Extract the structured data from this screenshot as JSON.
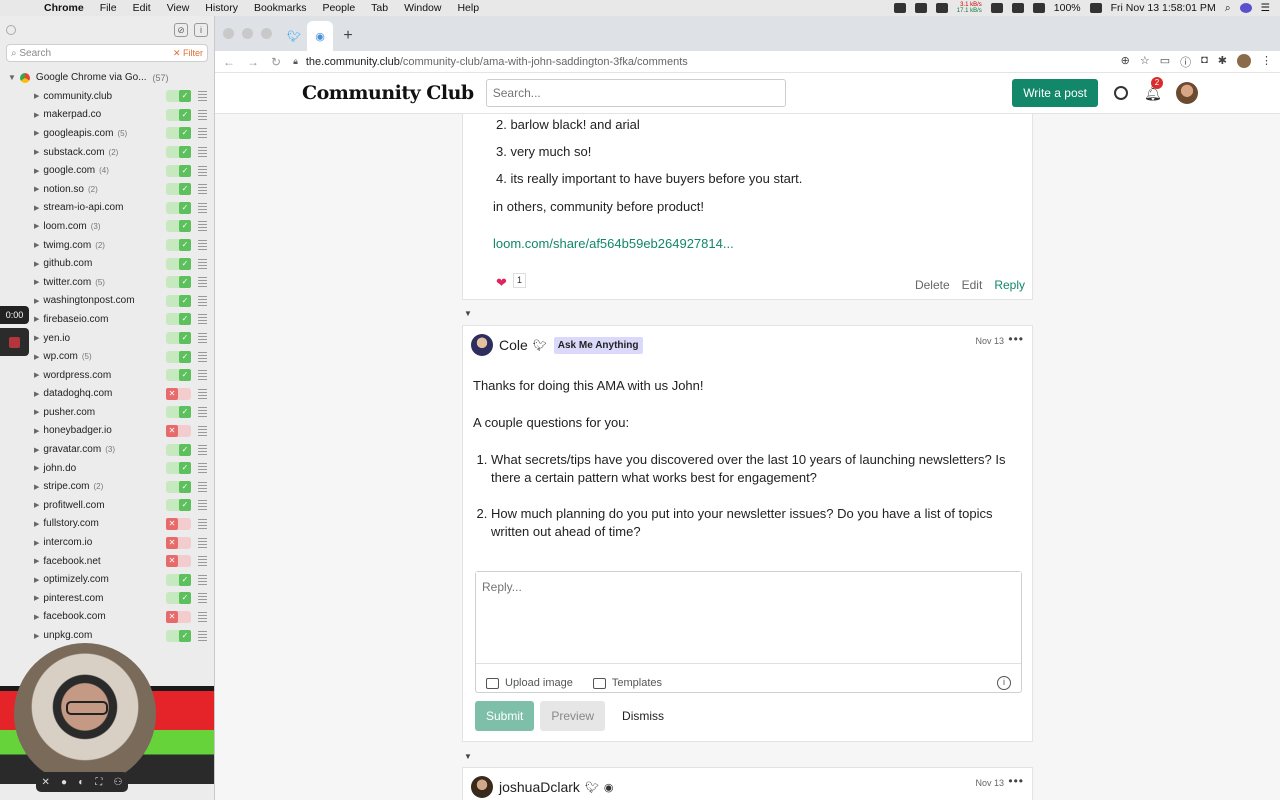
{
  "menubar": {
    "app": "Chrome",
    "items": [
      "File",
      "Edit",
      "View",
      "History",
      "Bookmarks",
      "People",
      "Tab",
      "Window",
      "Help"
    ],
    "net_up": "3.1 kB/s",
    "net_down": "17.1 kB/s",
    "battery": "100%",
    "datetime": "Fri Nov 13  1:58:01 PM"
  },
  "sidebar": {
    "search_placeholder": "Search",
    "filter_label": "Filter",
    "root": {
      "label": "Google Chrome via Go...",
      "count": "(57)"
    },
    "domains": [
      {
        "name": "community.club",
        "count": "",
        "state": "on"
      },
      {
        "name": "makerpad.co",
        "count": "",
        "state": "on"
      },
      {
        "name": "googleapis.com",
        "count": "(5)",
        "state": "on"
      },
      {
        "name": "substack.com",
        "count": "(2)",
        "state": "on"
      },
      {
        "name": "google.com",
        "count": "(4)",
        "state": "on"
      },
      {
        "name": "notion.so",
        "count": "(2)",
        "state": "on"
      },
      {
        "name": "stream-io-api.com",
        "count": "",
        "state": "on"
      },
      {
        "name": "loom.com",
        "count": "(3)",
        "state": "on"
      },
      {
        "name": "twimg.com",
        "count": "(2)",
        "state": "on"
      },
      {
        "name": "github.com",
        "count": "",
        "state": "on"
      },
      {
        "name": "twitter.com",
        "count": "(5)",
        "state": "on"
      },
      {
        "name": "washingtonpost.com",
        "count": "",
        "state": "on"
      },
      {
        "name": "firebaseio.com",
        "count": "",
        "state": "on"
      },
      {
        "name": "yen.io",
        "count": "",
        "state": "on"
      },
      {
        "name": "wp.com",
        "count": "(5)",
        "state": "on"
      },
      {
        "name": "wordpress.com",
        "count": "",
        "state": "on"
      },
      {
        "name": "datadoghq.com",
        "count": "",
        "state": "off"
      },
      {
        "name": "pusher.com",
        "count": "",
        "state": "on"
      },
      {
        "name": "honeybadger.io",
        "count": "",
        "state": "off"
      },
      {
        "name": "gravatar.com",
        "count": "(3)",
        "state": "on"
      },
      {
        "name": "john.do",
        "count": "",
        "state": "on"
      },
      {
        "name": "stripe.com",
        "count": "(2)",
        "state": "on"
      },
      {
        "name": "profitwell.com",
        "count": "",
        "state": "on"
      },
      {
        "name": "fullstory.com",
        "count": "",
        "state": "off"
      },
      {
        "name": "intercom.io",
        "count": "",
        "state": "off"
      },
      {
        "name": "facebook.net",
        "count": "",
        "state": "off"
      },
      {
        "name": "optimizely.com",
        "count": "",
        "state": "on"
      },
      {
        "name": "pinterest.com",
        "count": "",
        "state": "on"
      },
      {
        "name": "facebook.com",
        "count": "",
        "state": "off"
      },
      {
        "name": "unpkg.com",
        "count": "",
        "state": "on"
      }
    ],
    "timer": "0:00"
  },
  "browser": {
    "url_domain": "the.community.club",
    "url_path": "/community-club/ama-with-john-saddington-3fka/comments"
  },
  "site": {
    "logo": "Community Club",
    "search_placeholder": "Search...",
    "write_post": "Write a post",
    "notif_count": "2"
  },
  "comment1": {
    "items": [
      "2. barlow black! and arial",
      "3. very much so!",
      "4. its really important to have buyers before you start."
    ],
    "paragraph": "in others, community before product!",
    "link": "loom.com/share/af564b59eb264927814...",
    "like_count": "1",
    "actions": {
      "delete": "Delete",
      "edit": "Edit",
      "reply": "Reply"
    }
  },
  "comment2": {
    "author": "Cole",
    "badge": "Ask Me Anything",
    "date": "Nov 13",
    "p1": "Thanks for doing this AMA with us John!",
    "p2": "A couple questions for you:",
    "q1": "What secrets/tips have you discovered over the last 10 years of launching newsletters? Is there a certain pattern what works best for engagement?",
    "q2": "How much planning do you put into your newsletter issues? Do you have a list of topics written out ahead of time?",
    "reply_placeholder": "Reply...",
    "upload_image": "Upload image",
    "templates": "Templates",
    "submit": "Submit",
    "preview": "Preview",
    "dismiss": "Dismiss"
  },
  "comment3": {
    "author": "joshuaDclark",
    "date": "Nov 13"
  }
}
